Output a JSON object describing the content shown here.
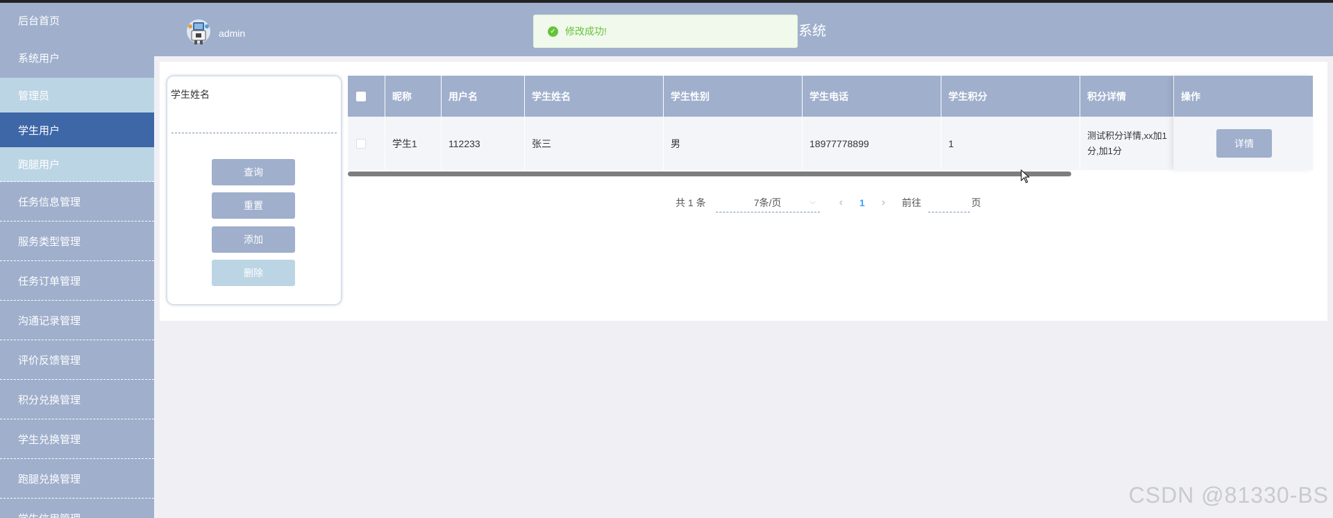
{
  "sidebar": {
    "items": [
      {
        "label": "后台首页"
      },
      {
        "label": "系统用户"
      },
      {
        "label": "管理员"
      },
      {
        "label": "学生用户"
      },
      {
        "label": "跑腿用户"
      },
      {
        "label": "任务信息管理"
      },
      {
        "label": "服务类型管理"
      },
      {
        "label": "任务订单管理"
      },
      {
        "label": "沟通记录管理"
      },
      {
        "label": "评价反馈管理"
      },
      {
        "label": "积分兑换管理"
      },
      {
        "label": "学生兑换管理"
      },
      {
        "label": "跑腿兑换管理"
      },
      {
        "label": "学生信用管理"
      }
    ]
  },
  "header": {
    "username": "admin",
    "system_title": "系统"
  },
  "toast": {
    "message": "修改成功!",
    "color": "#67c23a"
  },
  "search": {
    "label": "学生姓名",
    "value": "",
    "buttons": {
      "query": "查询",
      "reset": "重置",
      "add": "添加",
      "delete": "删除"
    }
  },
  "table": {
    "columns": [
      "昵称",
      "用户名",
      "学生姓名",
      "学生性别",
      "学生电话",
      "学生积分",
      "积分详情",
      "操作"
    ],
    "rows": [
      {
        "nickname": "学生1",
        "username": "112233",
        "student_name": "张三",
        "gender": "男",
        "phone": "18977778899",
        "points": "1",
        "points_detail": "测试积分详情,xx加1分,加1分",
        "action": "详情"
      }
    ]
  },
  "pagination": {
    "total": "共 1 条",
    "page_size": "7条/页",
    "current": "1",
    "goto_prefix": "前往",
    "goto_suffix": "页"
  },
  "watermark": "CSDN @81330-BS",
  "colors": {
    "primary": "#9fafcc",
    "active": "#3e67a7",
    "sub": "#bcd5e4"
  }
}
